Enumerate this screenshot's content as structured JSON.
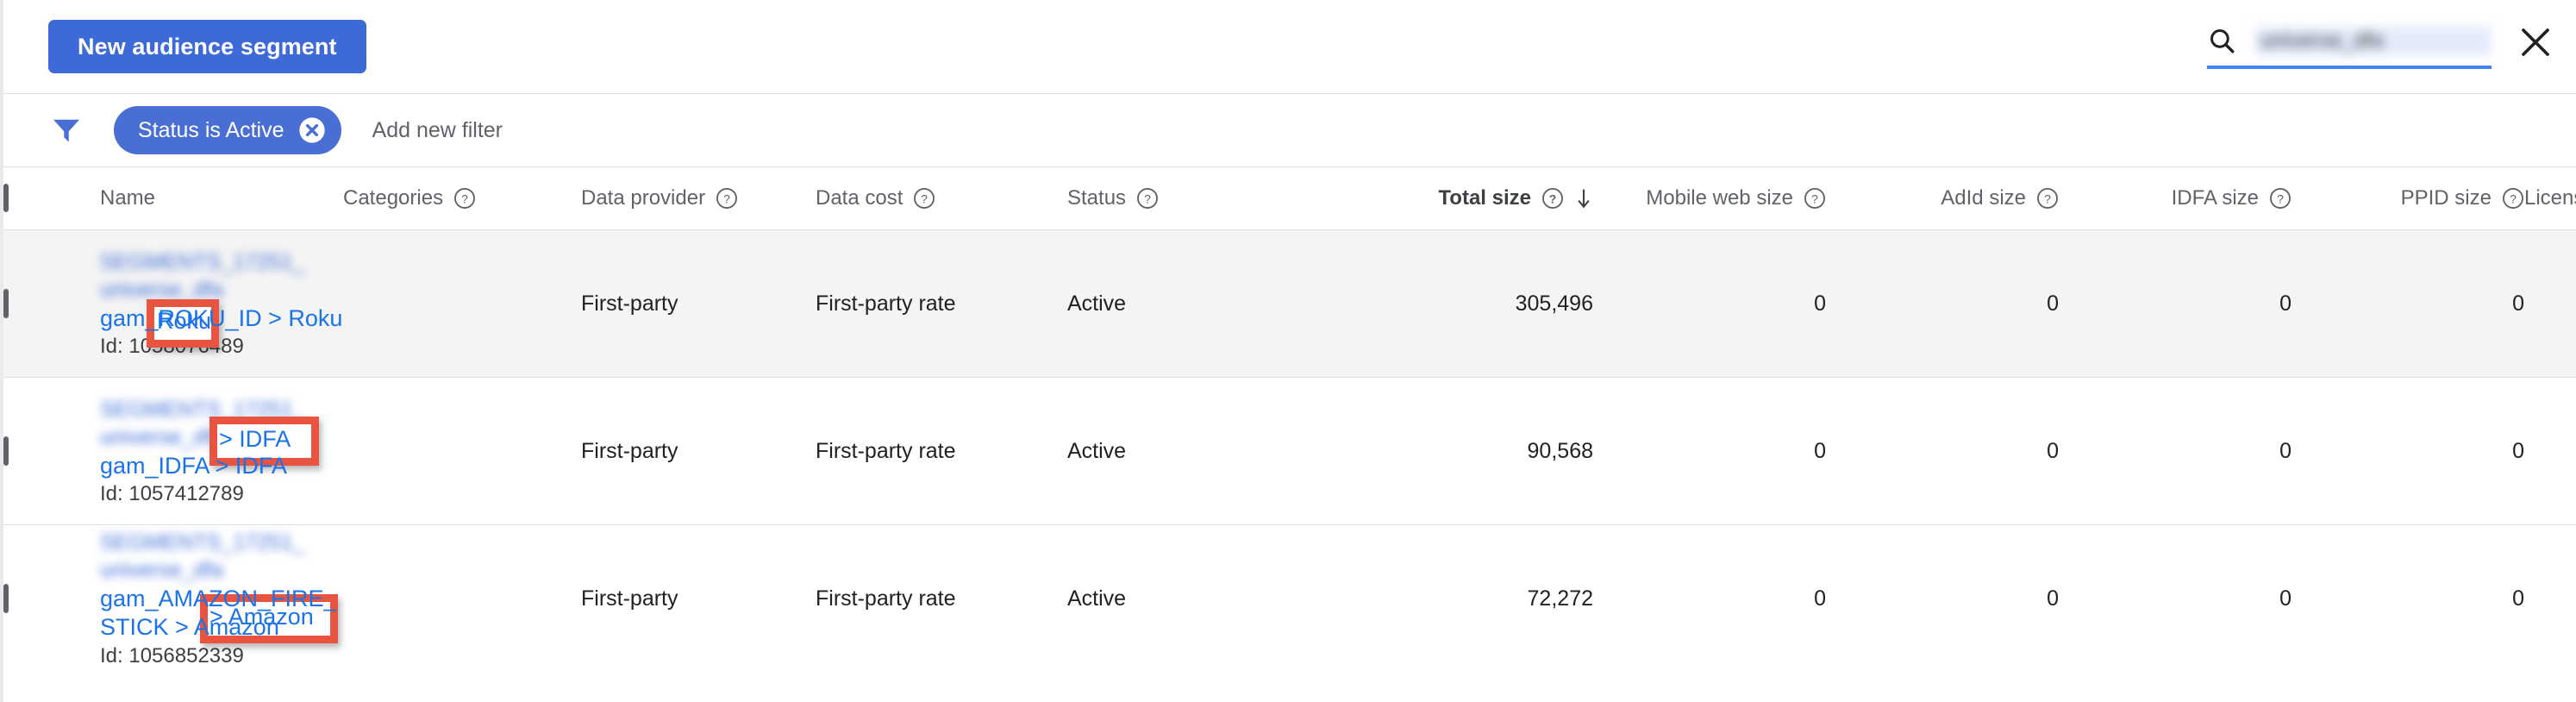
{
  "toolbar": {
    "new_segment_label": "New audience segment",
    "search_value": "universe_dfa",
    "search_icon": "search-icon",
    "clear_icon": "close-icon"
  },
  "filters": {
    "funnel_icon": "filter-funnel-icon",
    "active_chip": "Status is Active",
    "chip_remove_icon": "cancel-icon",
    "add_filter_label": "Add new filter"
  },
  "table": {
    "columns": [
      {
        "label": "Name",
        "help": false,
        "align": "left"
      },
      {
        "label": "Categories",
        "help": true,
        "align": "left"
      },
      {
        "label": "Data provider",
        "help": true,
        "align": "left"
      },
      {
        "label": "Data cost",
        "help": true,
        "align": "left"
      },
      {
        "label": "Status",
        "help": true,
        "align": "left"
      },
      {
        "label": "Total size",
        "help": true,
        "align": "right",
        "sorted": true,
        "sort_dir": "descending"
      },
      {
        "label": "Mobile web size",
        "help": true,
        "align": "right"
      },
      {
        "label": "AdId size",
        "help": true,
        "align": "right"
      },
      {
        "label": "IDFA size",
        "help": true,
        "align": "right"
      },
      {
        "label": "PPID size",
        "help": true,
        "align": "right"
      },
      {
        "label": "License type",
        "help": false,
        "align": "left"
      }
    ],
    "rows": [
      {
        "redacted_name": "SEGMENTS_17251_\nuniverse_dfa",
        "name": "gam_ROKU_ID > Roku",
        "id": "Id: 1058076489",
        "categories": "",
        "data_provider": "First-party",
        "data_cost": "First-party rate",
        "status": "Active",
        "total_size": "305,496",
        "mobile_web_size": "0",
        "adid_size": "0",
        "idfa_size": "0",
        "ppid_size": "0",
        "license_type": "",
        "highlighted": true,
        "annotation_text": "Roku"
      },
      {
        "redacted_name": "SEGMENTS_17251_\nuniverse_dfa",
        "name": "gam_IDFA > IDFA",
        "id": "Id: 1057412789",
        "categories": "",
        "data_provider": "First-party",
        "data_cost": "First-party rate",
        "status": "Active",
        "total_size": "90,568",
        "mobile_web_size": "0",
        "adid_size": "0",
        "idfa_size": "0",
        "ppid_size": "0",
        "license_type": "",
        "highlighted": false,
        "annotation_text": "> IDFA"
      },
      {
        "redacted_name": "SEGMENTS_17251_\nuniverse_dfa",
        "name": "gam_AMAZON_FIRE_STICK > Amazon",
        "id": "Id: 1056852339",
        "categories": "",
        "data_provider": "First-party",
        "data_cost": "First-party rate",
        "status": "Active",
        "total_size": "72,272",
        "mobile_web_size": "0",
        "adid_size": "0",
        "idfa_size": "0",
        "ppid_size": "0",
        "license_type": "",
        "highlighted": false,
        "annotation_text": "> Amazon"
      }
    ]
  },
  "colors": {
    "primary_blue": "#3d6ad6",
    "link_blue": "#1a73e8",
    "chip_blue": "#4a6fd4",
    "status_green": "#137333",
    "annotation_red": "#e8543f",
    "row_highlight": "#f4f4f4"
  }
}
